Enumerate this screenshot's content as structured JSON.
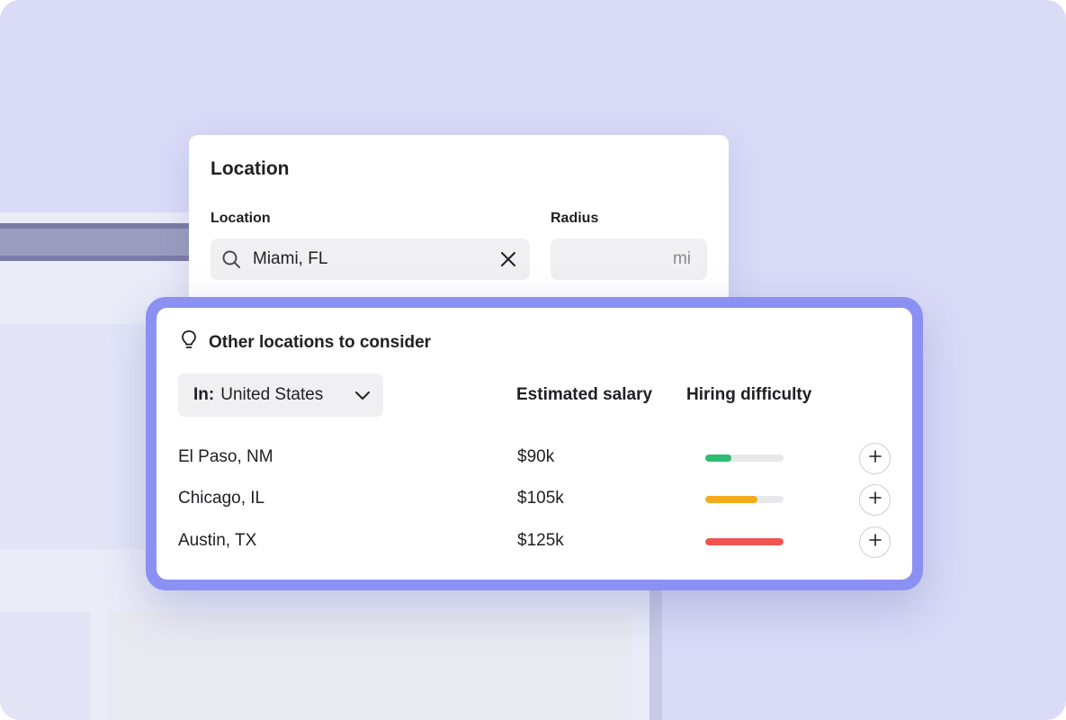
{
  "location_card": {
    "title": "Location",
    "location_label": "Location",
    "location_value": "Miami, FL",
    "radius_label": "Radius",
    "radius_value": "",
    "radius_unit": "mi"
  },
  "suggestions": {
    "title": "Other locations to consider",
    "filter": {
      "prefix": "In:",
      "value": "United States"
    },
    "columns": {
      "salary": "Estimated salary",
      "difficulty": "Hiring difficulty"
    },
    "rows": [
      {
        "city": "El Paso, NM",
        "salary": "$90k",
        "difficulty": 0.33,
        "color": "#2ebd72"
      },
      {
        "city": "Chicago, IL",
        "salary": "$105k",
        "difficulty": 0.67,
        "color": "#f4ac1c"
      },
      {
        "city": "Austin, TX",
        "salary": "$125k",
        "difficulty": 1.0,
        "color": "#f15353"
      }
    ]
  },
  "icons": {
    "search": "search-icon",
    "clear": "close-icon",
    "idea": "lightbulb-icon",
    "dropdown": "chevron-down-icon",
    "add": "plus-icon"
  }
}
